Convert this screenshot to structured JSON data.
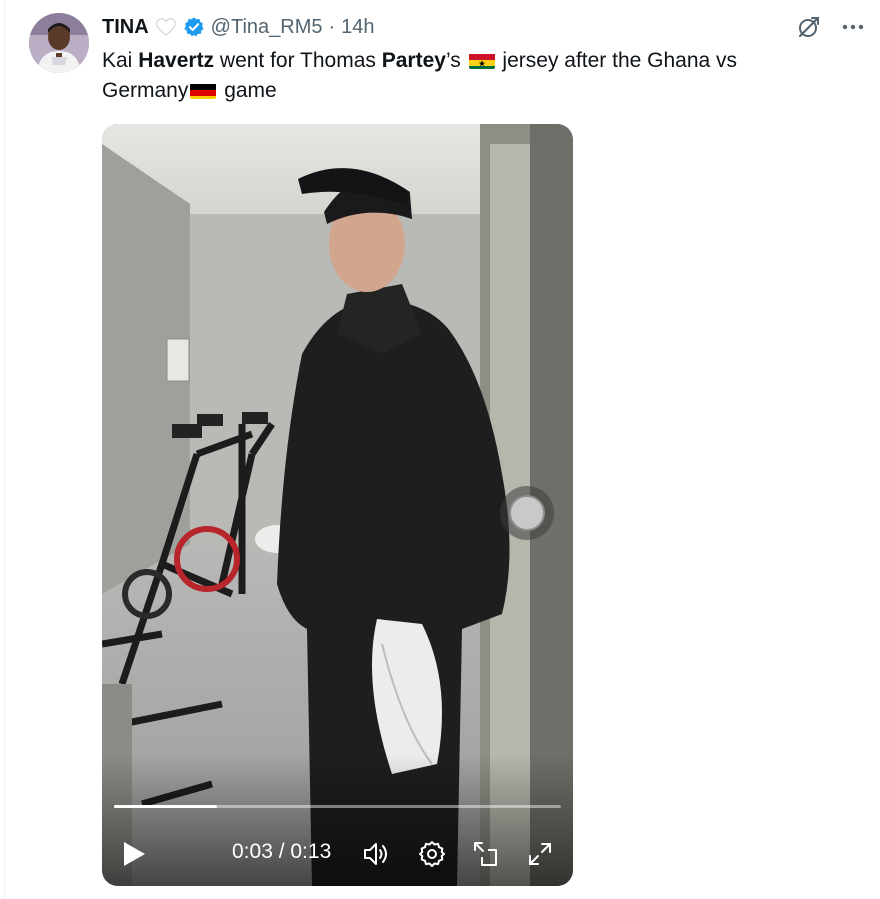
{
  "tweet": {
    "author_name": "TINA",
    "author_handle": "@Tina_RM5",
    "separator": "·",
    "time": "14h",
    "text_parts": {
      "p1": "Kai ",
      "p2": "Havertz",
      "p3": "  went for Thomas ",
      "p4": "Partey",
      "p5": "’s ",
      "p6": " jersey after the Ghana  vs",
      "p7": "Germany",
      "p8": " game"
    }
  },
  "icons": {
    "avatar": "avatar",
    "heart": "heart-icon",
    "verified": "verified-badge-icon",
    "grok": "grok-icon",
    "more": "more-icon",
    "ghana_flag": "ghana-flag-icon",
    "germany_flag": "germany-flag-icon",
    "play": "play-icon",
    "volume": "volume-icon",
    "settings": "settings-icon",
    "pip": "picture-in-picture-icon",
    "fullscreen": "fullscreen-icon"
  },
  "video": {
    "timecode": "0:03 / 0:13",
    "progress": 0.23
  },
  "colors": {
    "verified_blue": "#1d9bf0",
    "secondary_text": "#536471"
  }
}
